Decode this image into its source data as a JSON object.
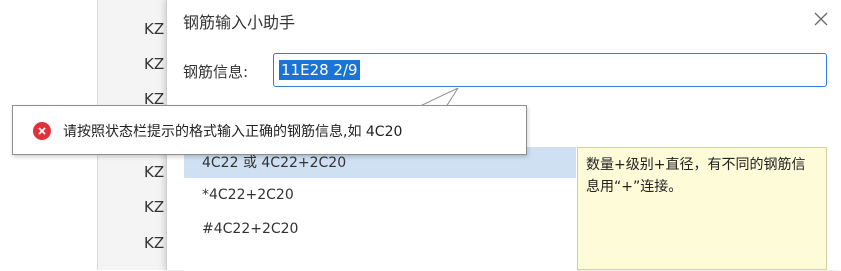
{
  "background": {
    "rows": [
      "KZ",
      "KZ",
      "KZ",
      "KZ",
      "KZ",
      "KZ",
      "KZ"
    ]
  },
  "dialog": {
    "title": "钢筋输入小助手",
    "field_label": "钢筋信息:",
    "input_value": "11E28 2/9",
    "list_items": [
      "4C22 或 4C22+2C20",
      "*4C22+2C20",
      "#4C22+2C20"
    ],
    "hint_text": "数量+级别+直径，有不同的钢筋信息用“+”连接。"
  },
  "tooltip": {
    "message": "请按照状态栏提示的格式输入正确的钢筋信息,如 4C20"
  },
  "icons": {
    "close": "close-icon",
    "error": "error-icon"
  },
  "colors": {
    "accent": "#2f7fd4",
    "selection": "#1a73d6",
    "list_selected": "#cfe0f3",
    "hint_bg": "#fefbd8",
    "error": "#e0323b"
  }
}
